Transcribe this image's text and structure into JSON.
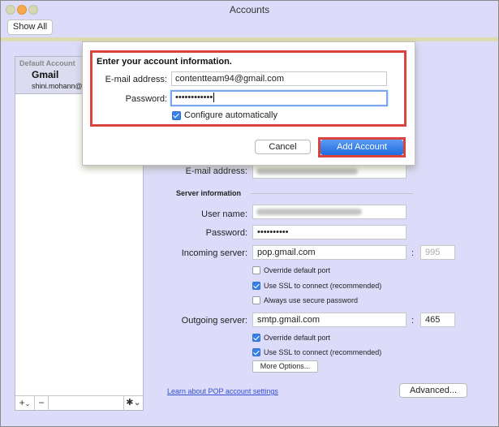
{
  "window": {
    "title": "Accounts",
    "show_all_label": "Show All"
  },
  "sidebar": {
    "default_label": "Default Account",
    "account_name": "Gmail",
    "account_email": "shini.mohann@g",
    "add_icon": "+",
    "add_chevron": "⌄",
    "remove_icon": "−",
    "gear_icon": "✱⌄"
  },
  "pane": {
    "email_label": "E-mail address:",
    "server_section": "Server information",
    "username_label": "User name:",
    "password_label": "Password:",
    "password_value": "••••••••••",
    "incoming_label": "Incoming server:",
    "incoming_value": "pop.gmail.com",
    "incoming_port": "995",
    "port_sep": ":",
    "incoming_override": "Override default port",
    "incoming_override_checked": false,
    "incoming_ssl": "Use SSL to connect (recommended)",
    "incoming_ssl_checked": true,
    "secure_password": "Always use secure password",
    "secure_password_checked": false,
    "outgoing_label": "Outgoing server:",
    "outgoing_value": "smtp.gmail.com",
    "outgoing_port": "465",
    "outgoing_override": "Override default port",
    "outgoing_override_checked": true,
    "outgoing_ssl": "Use SSL to connect (recommended)",
    "outgoing_ssl_checked": true,
    "more_options": "More Options...",
    "learn_link": "Learn about POP account settings",
    "advanced": "Advanced..."
  },
  "sheet": {
    "title": "Enter your account information.",
    "email_label": "E-mail address:",
    "email_value": "contentteam94@gmail.com",
    "password_label": "Password:",
    "password_value": "••••••••••••",
    "configure_label": "Configure automatically",
    "configure_checked": true,
    "cancel": "Cancel",
    "add_account": "Add Account",
    "highlight_color": "#d9443e"
  }
}
